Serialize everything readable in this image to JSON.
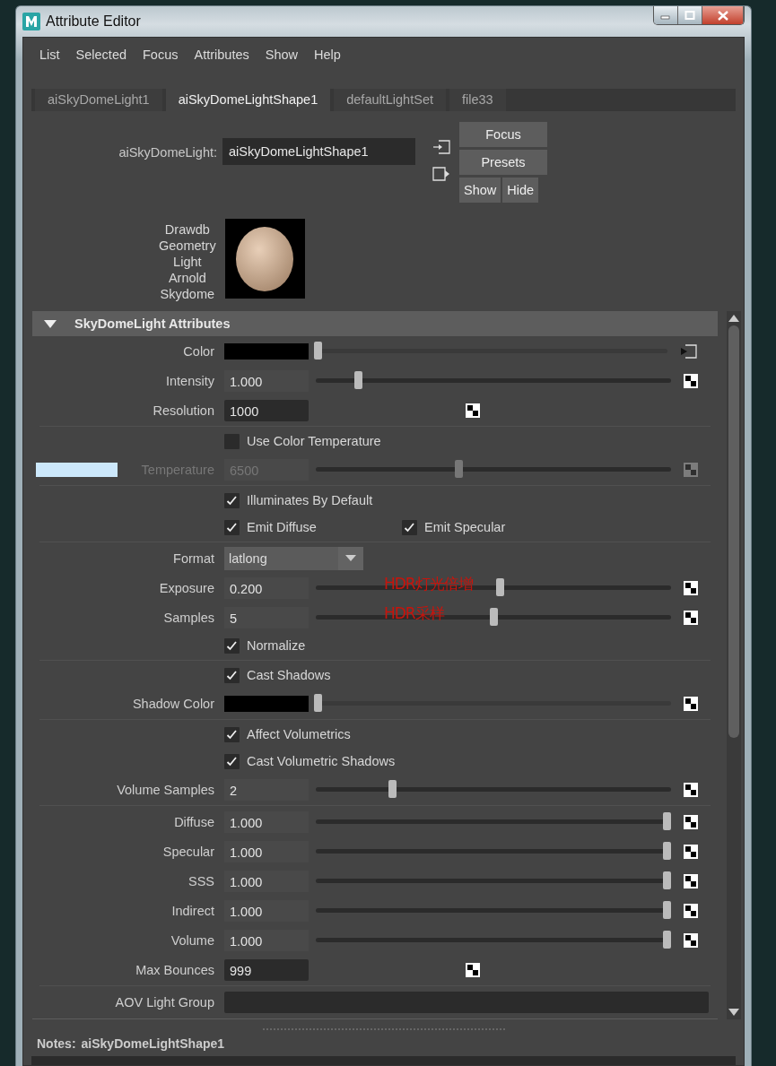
{
  "window": {
    "title": "Attribute Editor"
  },
  "menu": [
    "List",
    "Selected",
    "Focus",
    "Attributes",
    "Show",
    "Help"
  ],
  "tabs": [
    {
      "label": "aiSkyDomeLight1",
      "selected": false
    },
    {
      "label": "aiSkyDomeLightShape1",
      "selected": true
    },
    {
      "label": "defaultLightSet",
      "selected": false
    },
    {
      "label": "file33",
      "selected": false
    }
  ],
  "node": {
    "label": "aiSkyDomeLight:",
    "value": "aiSkyDomeLightShape1"
  },
  "buttons": {
    "focus": "Focus",
    "presets": "Presets",
    "show": "Show",
    "hide": "Hide"
  },
  "classification": "Drawdb\nGeometry\nLight\nArnold\nSkydome",
  "sections": [
    {
      "title": "SkyDomeLight Attributes",
      "expanded": true,
      "rows": [
        {
          "kind": "color_input",
          "label": "Color",
          "color": "#000000",
          "level": 0
        },
        {
          "kind": "slider",
          "label": "Intensity",
          "value": "1.000",
          "level": 0.11
        },
        {
          "kind": "field",
          "label": "Resolution",
          "value": "1000"
        },
        {
          "kind": "divider"
        },
        {
          "kind": "checks",
          "items": [
            {
              "label": "Use Color Temperature",
              "checked": false
            }
          ]
        },
        {
          "kind": "slider",
          "label": "Temperature",
          "value": "6500",
          "level": 0.4,
          "disabled": true,
          "color": "#cce8fb"
        },
        {
          "kind": "divider"
        },
        {
          "kind": "checks",
          "items": [
            {
              "label": "Illuminates By Default",
              "checked": true
            }
          ]
        },
        {
          "kind": "checks",
          "items": [
            {
              "label": "Emit Diffuse",
              "checked": true
            },
            {
              "label": "Emit Specular",
              "checked": true
            }
          ]
        },
        {
          "kind": "divider"
        },
        {
          "kind": "dropdown",
          "label": "Format",
          "value": "latlong"
        },
        {
          "kind": "slider",
          "label": "Exposure",
          "value": "0.200",
          "level": 0.52,
          "note": "HDR灯光倍增"
        },
        {
          "kind": "slider",
          "label": "Samples",
          "value": "5",
          "level": 0.5,
          "note": "HDR采样"
        },
        {
          "kind": "checks",
          "items": [
            {
              "label": "Normalize",
              "checked": true
            }
          ]
        },
        {
          "kind": "divider"
        },
        {
          "kind": "checks",
          "items": [
            {
              "label": "Cast Shadows",
              "checked": true
            }
          ]
        },
        {
          "kind": "color",
          "label": "Shadow Color",
          "color": "#000000",
          "level": 0
        },
        {
          "kind": "divider"
        },
        {
          "kind": "checks",
          "items": [
            {
              "label": "Affect Volumetrics",
              "checked": true
            }
          ]
        },
        {
          "kind": "checks",
          "items": [
            {
              "label": "Cast Volumetric Shadows",
              "checked": true
            }
          ]
        },
        {
          "kind": "slider",
          "label": "Volume Samples",
          "value": "2",
          "level": 0.21
        },
        {
          "kind": "divider"
        },
        {
          "kind": "slider",
          "label": "Diffuse",
          "value": "1.000",
          "level": 1
        },
        {
          "kind": "slider",
          "label": "Specular",
          "value": "1.000",
          "level": 1
        },
        {
          "kind": "slider",
          "label": "SSS",
          "value": "1.000",
          "level": 1
        },
        {
          "kind": "slider",
          "label": "Indirect",
          "value": "1.000",
          "level": 1
        },
        {
          "kind": "slider",
          "label": "Volume",
          "value": "1.000",
          "level": 1
        },
        {
          "kind": "field",
          "label": "Max Bounces",
          "value": "999"
        },
        {
          "kind": "divider"
        },
        {
          "kind": "text",
          "label": "AOV Light Group"
        }
      ]
    },
    {
      "expanded": true
    }
  ],
  "notes": {
    "label": "Notes:",
    "value": "aiSkyDomeLightShape1"
  }
}
